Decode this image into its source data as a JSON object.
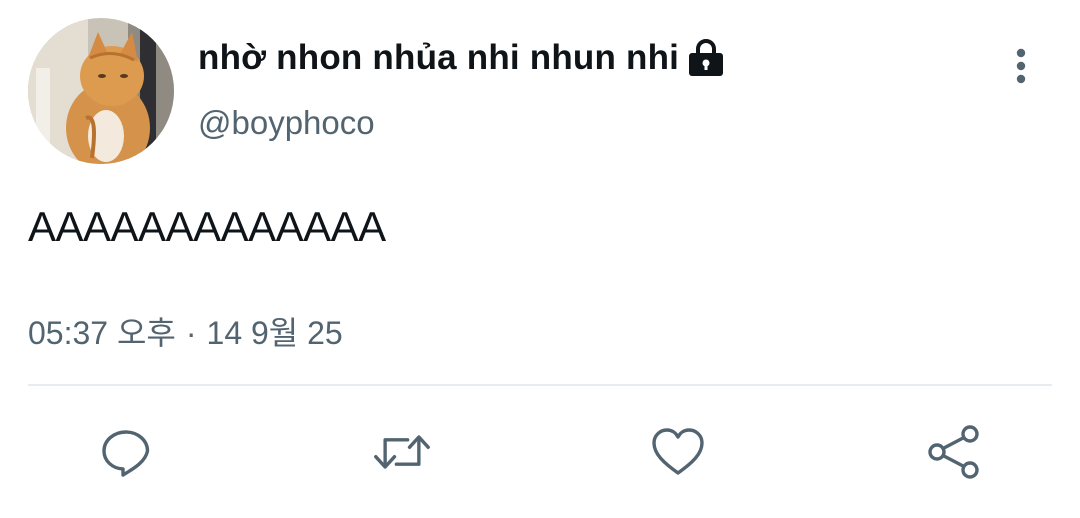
{
  "tweet": {
    "author": {
      "display_name": "nhờ nhon nhủa nhi nhun nhi",
      "handle": "@boyphoco",
      "protected": true,
      "avatar_icon": "orange-cat-photo"
    },
    "text": "AAAAAAAAAAAAA",
    "timestamp": {
      "time": "05:37 오후",
      "separator": "·",
      "date": "14 9월 25"
    }
  },
  "icons": {
    "lock": "lock-icon",
    "more": "more-vertical-icon",
    "reply": "reply-icon",
    "retweet": "retweet-icon",
    "like": "heart-icon",
    "share": "share-icon"
  },
  "colors": {
    "text_primary": "#0f1419",
    "text_secondary": "#536471",
    "icon": "#536471",
    "divider": "#e6ecf0"
  }
}
